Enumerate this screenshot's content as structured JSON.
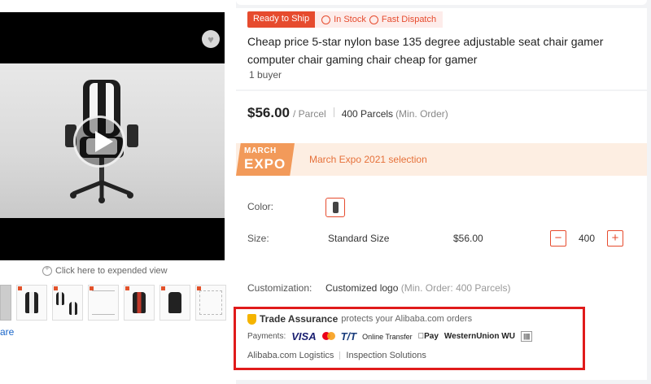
{
  "product": {
    "tag_ready": "Ready to Ship",
    "tag_in_stock": "In Stock",
    "tag_fast_dispatch": "Fast Dispatch",
    "title": "Cheap price 5-star nylon base 135 degree adjustable seat chair gamer computer chair gaming chair cheap for gamer",
    "buyers": "1 buyer"
  },
  "gallery": {
    "expand_text": "Click here to expended view",
    "share_text": "are",
    "thumbnails": [
      "dark-image",
      "black-white-chair",
      "white-chair-multi",
      "chair-diagram",
      "red-black-chair",
      "black-chair",
      "dimension-drawing"
    ]
  },
  "pricing": {
    "price": "$56.00",
    "unit": "/ Parcel",
    "moq_value": "400 Parcels",
    "moq_label": "(Min. Order)"
  },
  "expo": {
    "logo_line1": "MARCH",
    "logo_line2": "EXPO",
    "text": "March Expo 2021 selection"
  },
  "options": {
    "color_label": "Color:",
    "size_label": "Size:",
    "size_value": "Standard Size",
    "size_price": "$56.00",
    "quantity": "400",
    "minus": "−",
    "plus": "+",
    "customization_label": "Customization:",
    "customization_value": "Customized logo",
    "customization_note": "(Min. Order: 400 Parcels)"
  },
  "trade_assurance": {
    "title": "Trade Assurance",
    "subtitle": "protects your Alibaba.com orders",
    "payments_label": "Payments:",
    "methods": {
      "visa": "VISA",
      "tt": "T/T",
      "online": "Online Transfer",
      "applepay": "Pay",
      "wu": "WesternUnion WU",
      "boleto": "|||||||"
    },
    "link1": "Alibaba.com Logistics",
    "link2": "Inspection Solutions"
  },
  "colors": {
    "accent": "#e64b2e",
    "highlight_box": "#e01b1b",
    "expo_bg": "#fdeee2"
  }
}
